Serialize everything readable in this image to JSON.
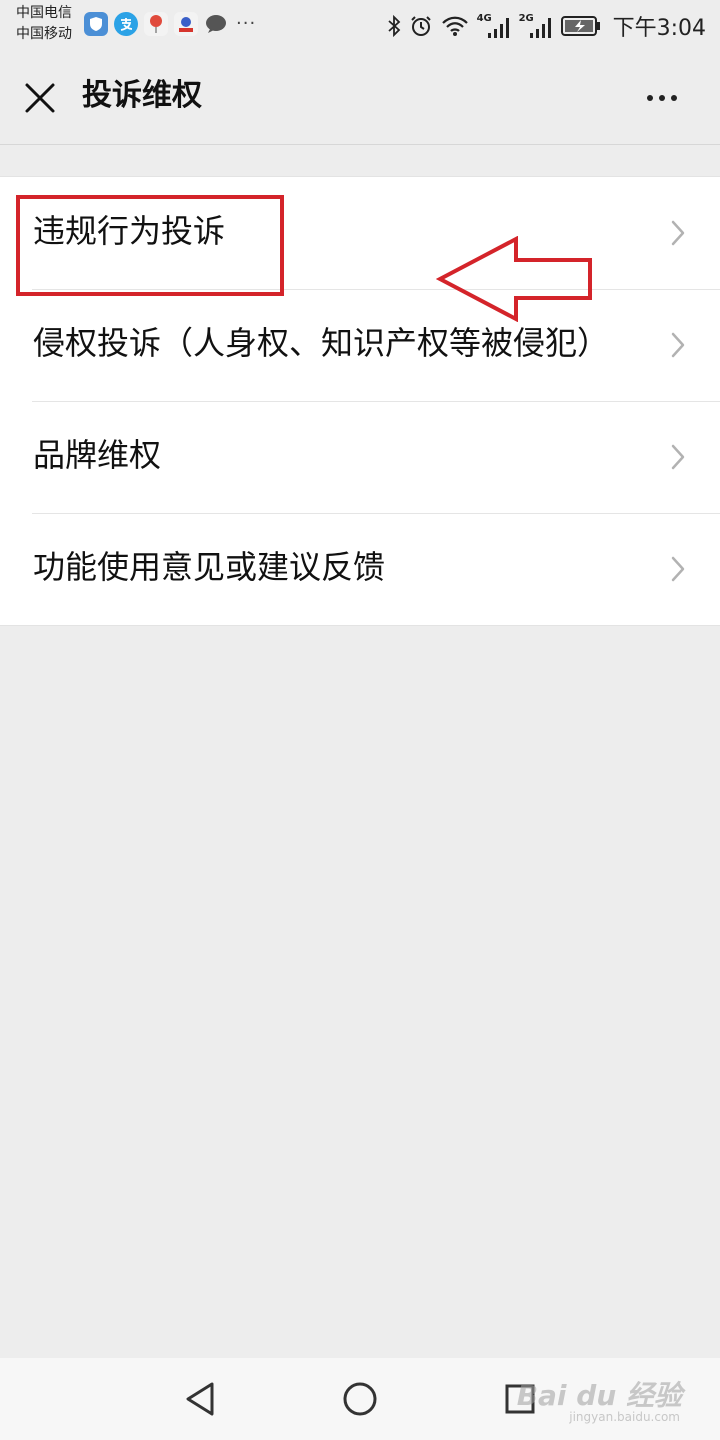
{
  "status_bar": {
    "carrier_1": "中国电信",
    "carrier_2": "中国移动",
    "time": "下午3:04",
    "net_1": "4G",
    "net_2": "2G",
    "icons": [
      "shield-app-icon",
      "alipay-icon",
      "balloon-app-icon",
      "baidu-app-icon",
      "chat-bubble-icon"
    ],
    "more_indicator": "···"
  },
  "navbar": {
    "title": "投诉维权"
  },
  "list": {
    "items": [
      {
        "label": "违规行为投诉"
      },
      {
        "label": "侵权投诉（人身权、知识产权等被侵犯）"
      },
      {
        "label": "品牌维权"
      },
      {
        "label": "功能使用意见或建议反馈"
      }
    ]
  },
  "watermark": {
    "text": "Bai du 经验",
    "sub": "jingyan.baidu.com"
  },
  "colors": {
    "annotation": "#d4242a",
    "background": "#ededed"
  }
}
